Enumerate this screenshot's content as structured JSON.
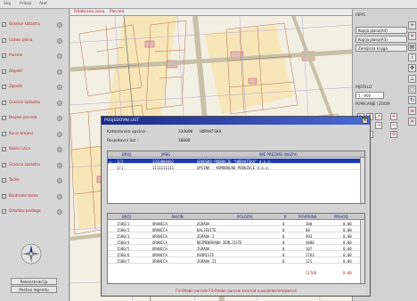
{
  "menubar": {
    "items": [
      "Sloj",
      "Prikaz",
      "Alat"
    ]
  },
  "map_tabs": {
    "tab1": "Odabrana zona",
    "tab2": "Parcela"
  },
  "layers": [
    {
      "label": "Granice katastra",
      "checked": true
    },
    {
      "label": "Listovi plana",
      "checked": true
    },
    {
      "label": "Parcele",
      "checked": true
    },
    {
      "label": "Objekti",
      "checked": true
    },
    {
      "label": "Zgrade",
      "checked": true
    },
    {
      "label": "Granice katastra",
      "checked": true
    },
    {
      "label": "Brojevi parcela",
      "checked": true
    },
    {
      "label": "Kucni brojevi",
      "checked": true
    },
    {
      "label": "Nazivi ulica",
      "checked": true
    },
    {
      "label": "Granica katastra",
      "checked": true
    },
    {
      "label": "Tocke",
      "checked": true
    },
    {
      "label": "Kontrolne tocke",
      "checked": true
    },
    {
      "label": "Ortofoto podloga",
      "checked": true
    }
  ],
  "left_buttons": {
    "b1": "Rekonstrukcija",
    "b2": "Postavi legendu"
  },
  "right_panel": {
    "copy_title": "ISPIS",
    "buttons": [
      "Kopija plana(A4)",
      "Kopija plana(A3)",
      "Zemljisna knjiga"
    ],
    "zoom_title": "MJERILO",
    "zoom_value": "1 : 900",
    "nav_title": "POMICANJE I ZOOM"
  },
  "dialog": {
    "title": "POSJEDOVNI LIST",
    "close": "×",
    "label_cadastre": "Katastarska opcina :",
    "cadastre_code": "334090",
    "cadastre_name": "HORVATSKA",
    "label_list": "Posjedovni list :",
    "list_no": "10008"
  },
  "owners": {
    "headers": [
      "BROJ",
      "JMBG",
      "IME PREZIME (NAZIV)"
    ],
    "rows": [
      {
        "no": "1/1",
        "id": "3333080402",
        "name": "GRADSKO PODRUCJE \"HORVATSKA\" d.o.o.",
        "selected": true
      },
      {
        "no": "1/1",
        "id": "1111111111",
        "name": "OPCINA - KOMUNALNO PODUZECE d.o.o.",
        "selected": false
      }
    ]
  },
  "parcels": {
    "headers": [
      "BROJ",
      "NACIN",
      "POLOZAJ",
      "K",
      "POVRSINA",
      "PRIHOD"
    ],
    "rows": [
      [
        "1580/1",
        "ORANICA",
        "ZGRADA",
        "0",
        "380",
        "0,00"
      ],
      [
        "1580/2",
        "ORANICA",
        "DALJEVITE",
        "0",
        "88",
        "0,00"
      ],
      [
        "1580/3",
        "ORANICA",
        "ZGRADA I",
        "0",
        "403",
        "0,00"
      ],
      [
        "1580/4",
        "ORANICA",
        "NEIMENOVANO ZEMLJISTE",
        "0",
        "4880",
        "0,00"
      ],
      [
        "1580/5",
        "ORANICA",
        "ZGRADA",
        "0",
        "107",
        "0,00"
      ],
      [
        "1580/6",
        "ORANICA",
        "DVORISTE",
        "0",
        "2763",
        "0,00"
      ],
      [
        "1580/7",
        "ORANICA",
        "ZGRADA II",
        "0",
        "125",
        "0,00"
      ]
    ],
    "total_area": "11788",
    "total_income": "0,00"
  },
  "status": "F3-Odabir parcele  F4-Odabir parcele kroz-kat o posjedovnim/parceli"
}
